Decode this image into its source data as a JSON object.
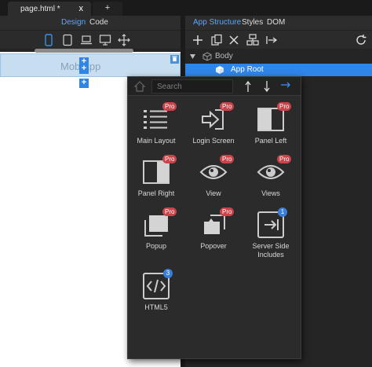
{
  "tabs": {
    "active_title": "page.html *",
    "close_symbol": "x",
    "new_tab_symbol": "+"
  },
  "left": {
    "design_label": "Design",
    "code_label": "Code",
    "canvas_text": "Mob   App"
  },
  "right": {
    "app_structure_label": "App Structure",
    "styles_label": "Styles",
    "dom_label": "DOM"
  },
  "tree": {
    "body_label": "Body",
    "approot_label": "App Root"
  },
  "popup": {
    "search_placeholder": "Search",
    "pro_label": "Pro",
    "items": [
      {
        "label": "Main Layout"
      },
      {
        "label": "Login Screen"
      },
      {
        "label": "Panel Left"
      },
      {
        "label": "Panel Right"
      },
      {
        "label": "View"
      },
      {
        "label": "Views"
      },
      {
        "label": "Popup"
      },
      {
        "label": "Popover"
      },
      {
        "label": "Server Side Includes",
        "badge": "1"
      },
      {
        "label": "HTML5",
        "badge": "3"
      }
    ]
  },
  "colors": {
    "accent": "#2f86e8",
    "pro": "#c9434b",
    "badge": "#3a7ed8"
  }
}
